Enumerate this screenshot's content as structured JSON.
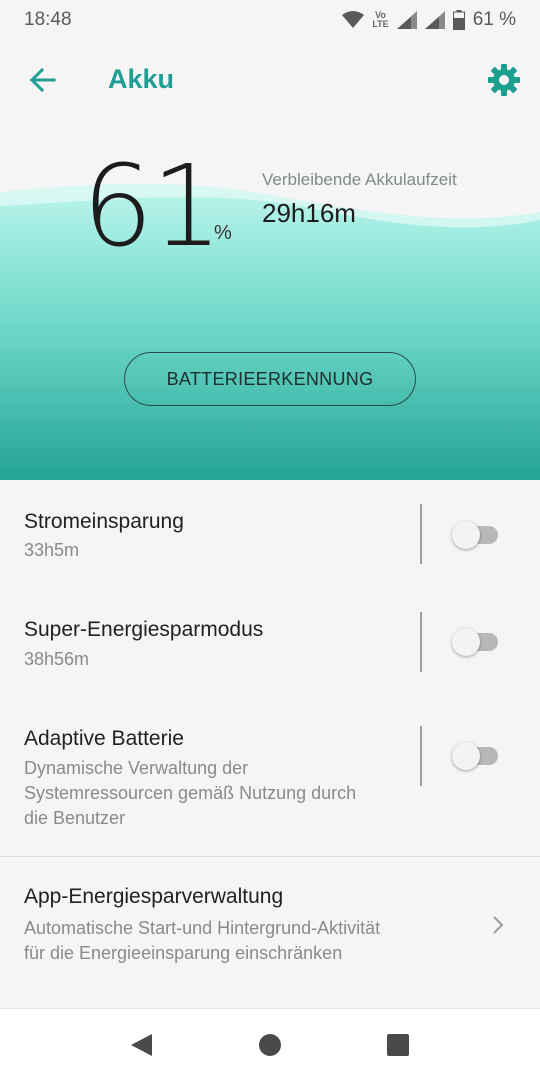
{
  "status": {
    "time": "18:48",
    "volte_top": "Vo",
    "volte_bottom": "LTE",
    "battery_text": "61 %",
    "icons": [
      "wifi-icon",
      "volte-icon",
      "signal-icon",
      "signal-icon",
      "battery-icon"
    ]
  },
  "header": {
    "title": "Akku",
    "back_icon": "arrow-left-icon",
    "settings_icon": "gear-icon"
  },
  "hero": {
    "percent": "61",
    "percent_unit": "%",
    "remaining_label": "Verbleibende Akkulaufzeit",
    "remaining_value": "29h16m",
    "detect_button": "BATTERIEERKENNUNG"
  },
  "settings": [
    {
      "title": "Stromeinsparung",
      "subtitle": "33h5m",
      "enabled": false
    },
    {
      "title": "Super-Energiesparmodus",
      "subtitle": "38h56m",
      "enabled": false
    },
    {
      "title": "Adaptive Batterie",
      "subtitle_lines": [
        "Dynamische Verwaltung der",
        "Systemressourcen gemäß Nutzung durch",
        "die Benutzer"
      ],
      "enabled": false
    }
  ],
  "app_manager": {
    "title": "App-Energiesparverwaltung",
    "subtitle_lines": [
      "Automatische Start-und Hintergrund-Aktivität",
      "für die Energieeinsparung einschränken"
    ]
  },
  "colors": {
    "accent": "#1f9e93",
    "wave_top": "#a8f0e6",
    "wave_bottom": "#26a597"
  },
  "navbar": {
    "icons": [
      "back-triangle-icon",
      "home-circle-icon",
      "recents-square-icon"
    ]
  }
}
